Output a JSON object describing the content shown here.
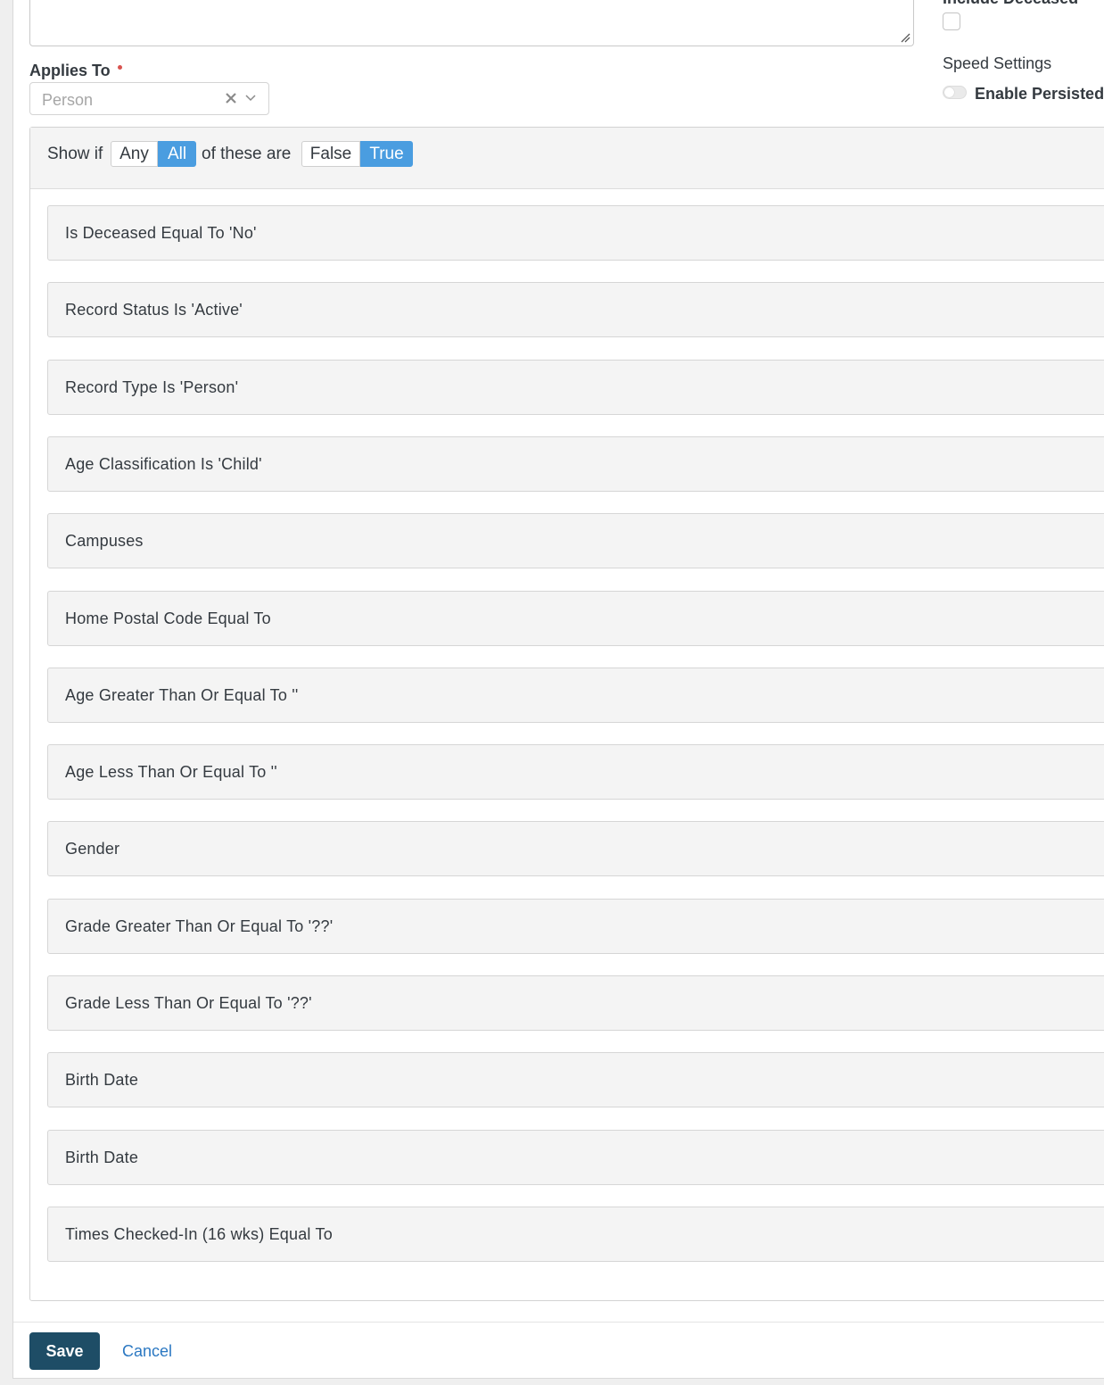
{
  "form": {
    "include_deceased_label": "Include Deceased",
    "applies_to_label": "Applies To",
    "applies_to_value": "Person",
    "speed_settings_label": "Speed Settings",
    "enable_persisted_label": "Enable Persisted"
  },
  "filter": {
    "show_if": "Show if",
    "any_label": "Any",
    "all_label": "All",
    "of_these_are": "of these are",
    "false_label": "False",
    "true_label": "True",
    "selected_match": "All",
    "selected_truth": "True",
    "rules": [
      "Is Deceased Equal To 'No'",
      "Record Status Is 'Active'",
      "Record Type Is 'Person'",
      "Age Classification Is 'Child'",
      "Campuses",
      "Home Postal Code Equal To",
      "Age Greater Than Or Equal To ''",
      "Age Less Than Or Equal To ''",
      "Gender",
      "Grade Greater Than Or Equal To '??'",
      "Grade Less Than Or Equal To '??'",
      "Birth Date",
      "Birth Date",
      "Times Checked-In (16 wks) Equal To"
    ]
  },
  "footer": {
    "save_label": "Save",
    "cancel_label": "Cancel"
  },
  "colors": {
    "accent": "#4a9de0",
    "primary_button": "#1e4d66",
    "link": "#2b78c2",
    "required": "#d9534f"
  }
}
